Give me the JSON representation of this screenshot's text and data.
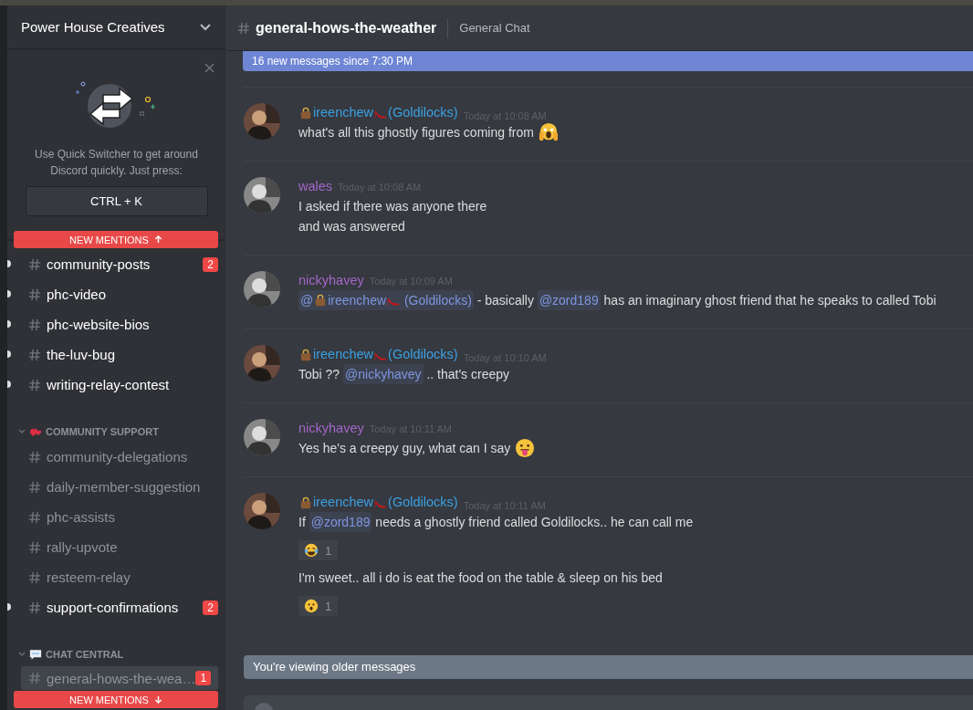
{
  "sidebar": {
    "server_name": "Power House Creatives",
    "quick_switcher": {
      "text": "Use Quick Switcher to get around Discord quickly. Just press:",
      "shortcut": "CTRL + K"
    },
    "new_mentions_top": "NEW MENTIONS",
    "new_mentions_bottom": "NEW MENTIONS",
    "categories": [
      {
        "channels": [
          {
            "name": "community-posts",
            "unread": true,
            "selected": false,
            "badge": "2"
          },
          {
            "name": "phc-video",
            "unread": true,
            "selected": false
          },
          {
            "name": "phc-website-bios",
            "unread": true,
            "selected": false
          },
          {
            "name": "the-luv-bug",
            "unread": true,
            "selected": false
          },
          {
            "name": "writing-relay-contest",
            "unread": true,
            "selected": false
          }
        ]
      },
      {
        "label": "COMMUNITY SUPPORT",
        "channels": [
          {
            "name": "community-delegations",
            "unread": false,
            "selected": false
          },
          {
            "name": "daily-member-suggestion",
            "unread": false,
            "selected": false
          },
          {
            "name": "phc-assists",
            "unread": false,
            "selected": false
          },
          {
            "name": "rally-upvote",
            "unread": false,
            "selected": false
          },
          {
            "name": "resteem-relay",
            "unread": false,
            "selected": false
          },
          {
            "name": "support-confirmations",
            "unread": true,
            "selected": false,
            "badge": "2"
          }
        ]
      },
      {
        "label": "CHAT CENTRAL",
        "channels": [
          {
            "name": "general-hows-the-wea…",
            "unread": false,
            "selected": true,
            "badge": "1"
          }
        ]
      }
    ]
  },
  "header": {
    "channel": "general-hows-the-weather",
    "topic": "General Chat"
  },
  "new_messages_banner": "16 new messages since 7:30 PM",
  "messages": [
    {
      "color": "#3ba0e3",
      "time": "Today at 10:08 AM",
      "author": [
        {
          "kind": "bag"
        },
        {
          "kind": "text",
          "text": "ireenchew"
        },
        {
          "kind": "heel"
        },
        {
          "kind": "text",
          "text": " (Goldilocks)"
        }
      ],
      "body": [
        {
          "kind": "line",
          "parts": [
            {
              "kind": "text",
              "text": "what's all this ghostly figures coming from "
            },
            {
              "kind": "scream"
            }
          ]
        }
      ]
    },
    {
      "color": "#a366c9",
      "time": "Today at 10:08 AM",
      "author": [
        {
          "kind": "text",
          "text": "wales"
        }
      ],
      "body": [
        {
          "kind": "line",
          "parts": [
            {
              "kind": "text",
              "text": "I asked if there was anyone there"
            }
          ]
        },
        {
          "kind": "line",
          "parts": [
            {
              "kind": "text",
              "text": "and was answered"
            }
          ]
        }
      ]
    },
    {
      "color": "#a366c9",
      "time": "Today at 10:09 AM",
      "author": [
        {
          "kind": "text",
          "text": "nickyhavey"
        }
      ],
      "body": [
        {
          "kind": "line",
          "parts": [
            {
              "kind": "mention",
              "parts": [
                {
                  "kind": "text",
                  "text": "@"
                },
                {
                  "kind": "bag"
                },
                {
                  "kind": "text",
                  "text": "ireenchew"
                },
                {
                  "kind": "heel"
                },
                {
                  "kind": "text",
                  "text": " (Goldilocks)"
                }
              ]
            },
            {
              "kind": "text",
              "text": " - basically "
            },
            {
              "kind": "mention",
              "parts": [
                {
                  "kind": "text",
                  "text": "@zord189"
                }
              ]
            },
            {
              "kind": "text",
              "text": " has an imaginary ghost friend that he speaks to called Tobi"
            }
          ]
        }
      ]
    },
    {
      "color": "#3ba0e3",
      "time": "Today at 10:10 AM",
      "author": [
        {
          "kind": "bag"
        },
        {
          "kind": "text",
          "text": "ireenchew"
        },
        {
          "kind": "heel"
        },
        {
          "kind": "text",
          "text": " (Goldilocks)"
        }
      ],
      "body": [
        {
          "kind": "line",
          "parts": [
            {
              "kind": "text",
              "text": "Tobi ?? "
            },
            {
              "kind": "mention",
              "parts": [
                {
                  "kind": "text",
                  "text": "@nickyhavey"
                }
              ]
            },
            {
              "kind": "text",
              "text": " .. that's creepy"
            }
          ]
        }
      ]
    },
    {
      "color": "#a366c9",
      "time": "Today at 10:11 AM",
      "author": [
        {
          "kind": "text",
          "text": "nickyhavey"
        }
      ],
      "body": [
        {
          "kind": "line",
          "parts": [
            {
              "kind": "text",
              "text": "Yes he's a creepy guy, what can I say "
            },
            {
              "kind": "tongue"
            }
          ]
        }
      ]
    },
    {
      "color": "#3ba0e3",
      "time": "Today at 10:11 AM",
      "author": [
        {
          "kind": "bag"
        },
        {
          "kind": "text",
          "text": "ireenchew"
        },
        {
          "kind": "heel"
        },
        {
          "kind": "text",
          "text": " (Goldilocks)"
        }
      ],
      "body": [
        {
          "kind": "line",
          "parts": [
            {
              "kind": "text",
              "text": "If "
            },
            {
              "kind": "mention",
              "parts": [
                {
                  "kind": "text",
                  "text": "@zord189"
                }
              ]
            },
            {
              "kind": "text",
              "text": " needs a ghostly friend called Goldilocks.. he can call me"
            }
          ]
        },
        {
          "kind": "reaction",
          "icon": [
            {
              "kind": "joy"
            }
          ],
          "count": "1"
        },
        {
          "kind": "line",
          "parts": [
            {
              "kind": "text",
              "text": "I'm sweet.. all i do is eat the food on the table & sleep on his bed"
            }
          ]
        },
        {
          "kind": "reaction",
          "icon": [
            {
              "kind": "hushed"
            }
          ],
          "count": "1"
        }
      ]
    }
  ],
  "older_messages_bar": "You're viewing older messages"
}
